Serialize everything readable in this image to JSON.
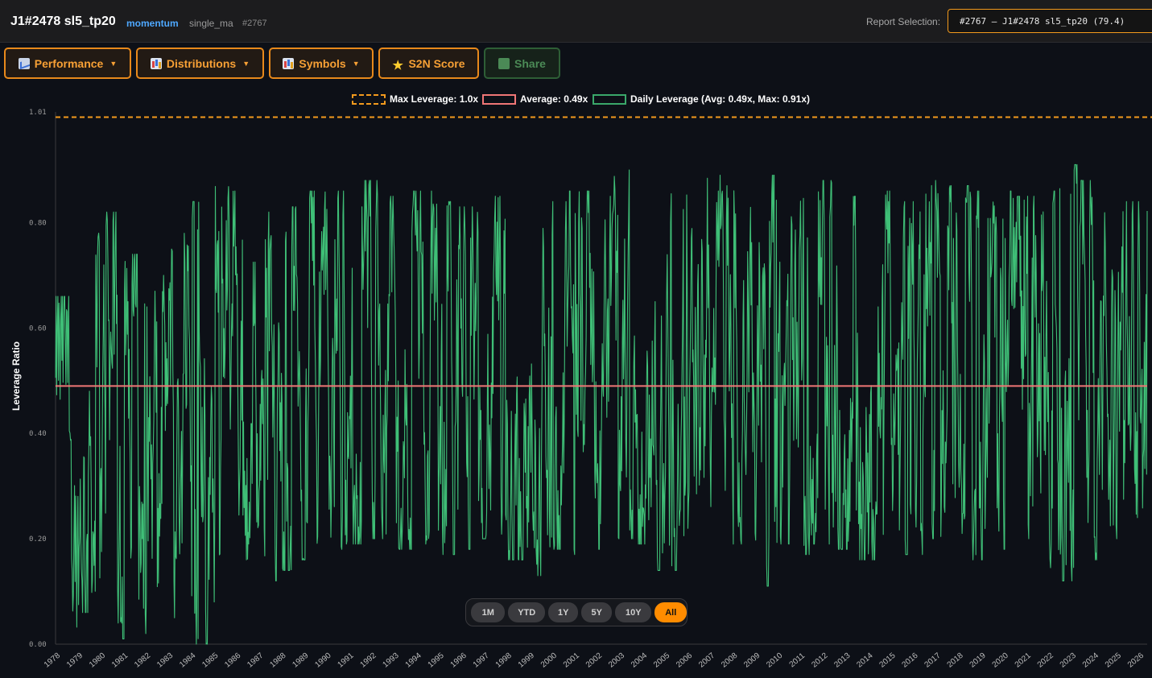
{
  "header": {
    "title": "J1#2478 sl5_tp20",
    "strategy": "momentum",
    "model": "single_ma",
    "id": "#2767",
    "report_label": "Report Selection:",
    "report_value": "#2767 — J1#2478 sl5_tp20 (79.4)"
  },
  "toolbar": {
    "performance": "Performance",
    "distributions": "Distributions",
    "symbols": "Symbols",
    "s2n": "S2N Score",
    "share": "Share"
  },
  "legend": {
    "max": "Max Leverage: 1.0x",
    "avg": "Average: 0.49x",
    "daily": "Daily Leverage (Avg: 0.49x, Max: 0.91x)"
  },
  "range_buttons": [
    "1M",
    "YTD",
    "1Y",
    "5Y",
    "10Y",
    "All"
  ],
  "range_active": "All",
  "colors": {
    "accent": "#f39a1d",
    "series": "#3fbf77",
    "average": "#f07676",
    "max_line": "#f39a1d"
  },
  "chart_data": {
    "type": "line",
    "title": "",
    "xlabel": "",
    "ylabel": "Leverage Ratio",
    "x_range": [
      "1978",
      "2026"
    ],
    "x_ticks": [
      "1978",
      "1979",
      "1980",
      "1981",
      "1982",
      "1983",
      "1984",
      "1985",
      "1986",
      "1987",
      "1988",
      "1989",
      "1990",
      "1991",
      "1992",
      "1993",
      "1994",
      "1995",
      "1996",
      "1997",
      "1998",
      "1999",
      "2000",
      "2001",
      "2002",
      "2003",
      "2004",
      "2005",
      "2006",
      "2007",
      "2008",
      "2009",
      "2010",
      "2011",
      "2012",
      "2013",
      "2014",
      "2015",
      "2016",
      "2017",
      "2018",
      "2019",
      "2020",
      "2021",
      "2022",
      "2023",
      "2024",
      "2025",
      "2026"
    ],
    "y_ticks": [
      "0.00",
      "0.20",
      "0.40",
      "0.60",
      "0.80",
      "1.01"
    ],
    "ylim": [
      0,
      1.01
    ],
    "max_leverage": 1.0,
    "average": 0.49,
    "series_max": 0.91,
    "grid": false,
    "legend_position": "top-center",
    "series": [
      {
        "name": "Daily Leverage (Avg: 0.49x, Max: 0.91x)",
        "yearly_range": [
          [
            0.0,
            0.66
          ],
          [
            0.06,
            0.78
          ],
          [
            0.04,
            0.82
          ],
          [
            0.01,
            0.74
          ],
          [
            0.02,
            0.7
          ],
          [
            0.05,
            0.78
          ],
          [
            0.0,
            0.84
          ],
          [
            0.08,
            0.88
          ],
          [
            0.16,
            0.86
          ],
          [
            0.12,
            0.82
          ],
          [
            0.14,
            0.83
          ],
          [
            0.16,
            0.86
          ],
          [
            0.18,
            0.86
          ],
          [
            0.19,
            0.88
          ],
          [
            0.2,
            0.88
          ],
          [
            0.18,
            0.85
          ],
          [
            0.19,
            0.86
          ],
          [
            0.17,
            0.84
          ],
          [
            0.18,
            0.83
          ],
          [
            0.2,
            0.85
          ],
          [
            0.16,
            0.83
          ],
          [
            0.13,
            0.82
          ],
          [
            0.18,
            0.84
          ],
          [
            0.17,
            0.86
          ],
          [
            0.18,
            0.85
          ],
          [
            0.2,
            0.9
          ],
          [
            0.19,
            0.89
          ],
          [
            0.14,
            0.88
          ],
          [
            0.19,
            0.88
          ],
          [
            0.17,
            0.89
          ],
          [
            0.19,
            0.87
          ],
          [
            0.11,
            0.84
          ],
          [
            0.19,
            0.89
          ],
          [
            0.17,
            0.86
          ],
          [
            0.19,
            0.88
          ],
          [
            0.18,
            0.85
          ],
          [
            0.16,
            0.84
          ],
          [
            0.17,
            0.86
          ],
          [
            0.17,
            0.84
          ],
          [
            0.2,
            0.88
          ],
          [
            0.21,
            0.87
          ],
          [
            0.16,
            0.86
          ],
          [
            0.18,
            0.86
          ],
          [
            0.2,
            0.85
          ],
          [
            0.13,
            0.86
          ],
          [
            0.12,
            0.91
          ],
          [
            0.16,
            0.88
          ],
          [
            0.2,
            0.9
          ],
          [
            0.24,
            0.84
          ]
        ]
      }
    ]
  }
}
